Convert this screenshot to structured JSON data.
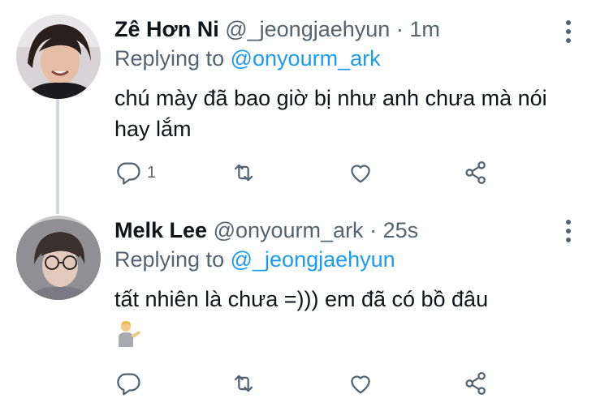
{
  "tweets": [
    {
      "name": "Zê Hơn Ni",
      "handle": "@_jeongjaehyun",
      "dot": "·",
      "time": "1m",
      "replying_label": "Replying to",
      "replying_to": "@onyourm_ark",
      "body": "chú mày đã bao giờ bị như anh chưa mà nói hay lắm",
      "reply_count": "1"
    },
    {
      "name": "Melk Lee",
      "handle": "@onyourm_ark",
      "dot": "·",
      "time": "25s",
      "replying_label": "Replying to",
      "replying_to": "@_jeongjaehyun",
      "body": "tất nhiên là chưa =))) em đã có bồ đâu",
      "reply_count": ""
    }
  ],
  "icons": {
    "reply": "reply-icon",
    "retweet": "retweet-icon",
    "like": "heart-icon",
    "share": "share-icon",
    "more": "more-vertical-icon"
  },
  "colors": {
    "link": "#1d9bf0",
    "secondary": "#536471",
    "thread_line": "#cfd9de"
  }
}
